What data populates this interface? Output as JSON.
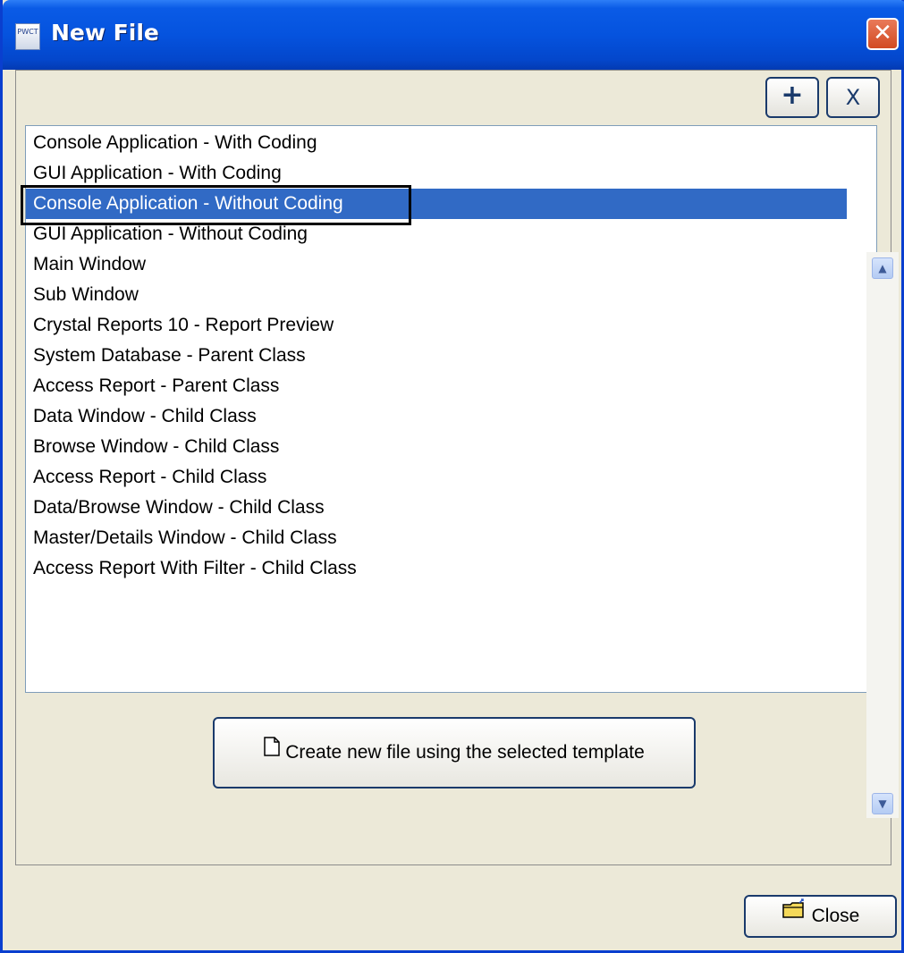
{
  "window": {
    "title": "New File",
    "icon_label": "PWCT",
    "close_glyph": "✕"
  },
  "toolbar": {
    "add_label": "+",
    "delete_label": "X"
  },
  "templates": {
    "selected_index": 2,
    "items": [
      "Console Application - With Coding",
      "GUI Application - With Coding",
      "Console Application - Without Coding",
      "GUI Application - Without Coding",
      "Main Window",
      "Sub Window",
      "Crystal Reports 10 - Report Preview",
      "System Database - Parent Class",
      "Access Report - Parent Class",
      "Data Window - Child Class",
      "Browse Window - Child Class",
      "Access Report - Child Class",
      "Data/Browse Window - Child Class",
      "Master/Details Window - Child Class",
      "Access Report With Filter - Child Class"
    ]
  },
  "actions": {
    "create_label": "Create new file using the selected template",
    "close_label": "Close"
  },
  "icons": {
    "title": "app-icon",
    "create": "document-icon",
    "close": "folder-icon"
  },
  "colors": {
    "titlebar": "#0553de",
    "selection": "#316ac5",
    "close_button": "#d24a21",
    "window_bg": "#ece9d8"
  }
}
